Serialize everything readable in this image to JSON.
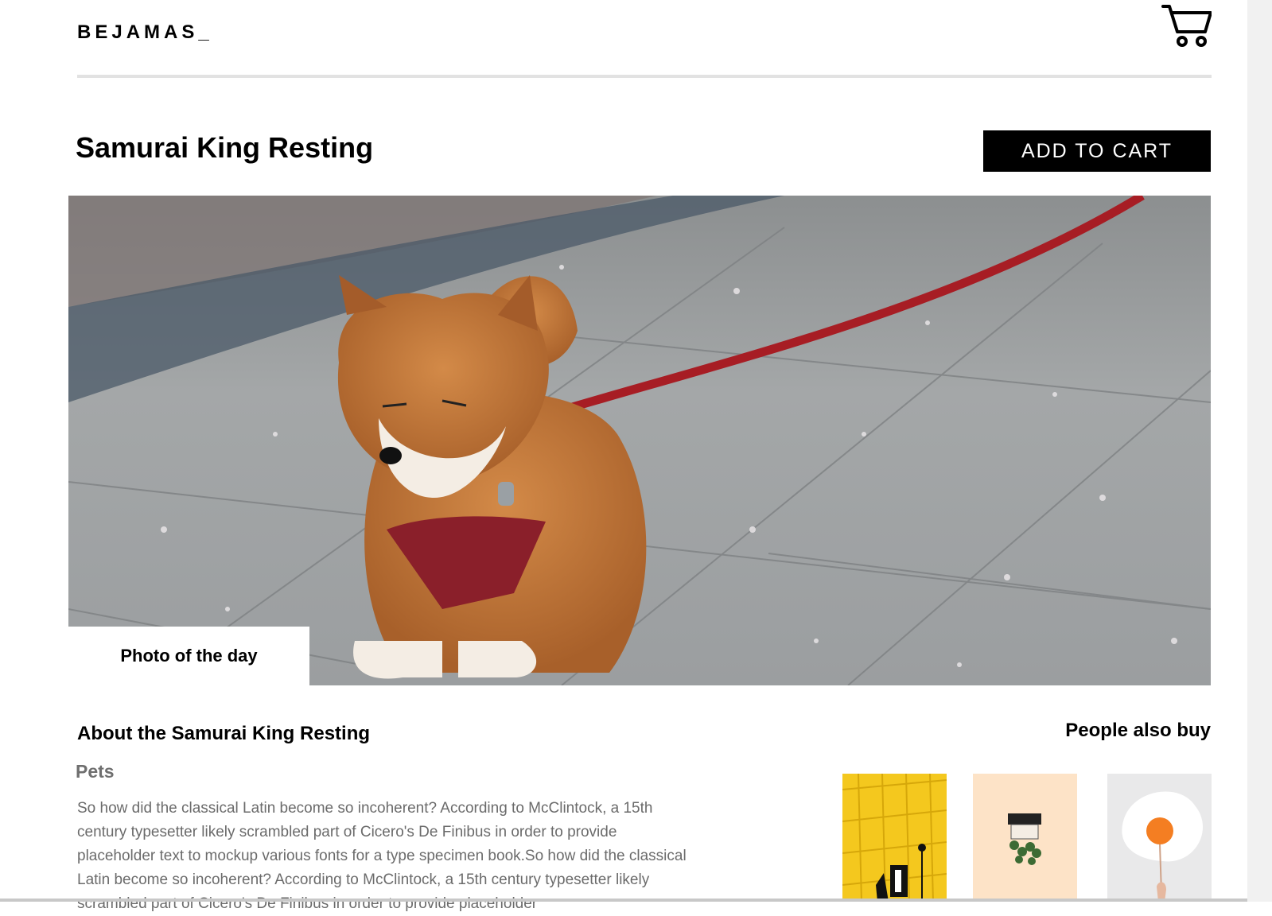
{
  "header": {
    "logo": "BEJAMAS_",
    "cart_icon": "shopping-cart-icon"
  },
  "product": {
    "title": "Samurai King Resting",
    "add_to_cart_label": "ADD TO CART",
    "photo_badge": "Photo of the day"
  },
  "about": {
    "heading": "About the Samurai King Resting",
    "category": "Pets",
    "description": "So how did the classical Latin become so incoherent? According to McClintock, a 15th century typesetter likely scrambled part of Cicero's De Finibus in order to provide placeholder text to mockup various fonts for a type specimen book.So how did the classical Latin become so incoherent? According to McClintock, a 15th century typesetter likely scrambled part of Cicero's De Finibus in order to provide placeholder"
  },
  "recommendations": {
    "heading": "People also buy"
  },
  "colors": {
    "accent": "#000000",
    "text_muted": "#6b6b6b",
    "rule": "#e2e2e2"
  }
}
